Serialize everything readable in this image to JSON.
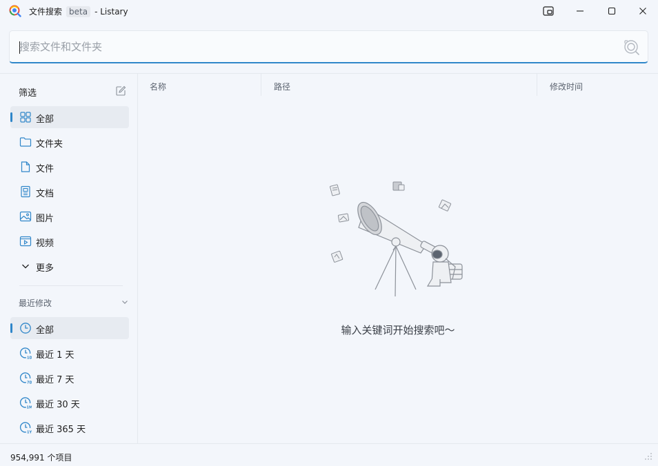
{
  "window": {
    "title": "文件搜索",
    "badge": "beta",
    "app_name": "- Listary"
  },
  "search": {
    "value": "",
    "placeholder": "搜索文件和文件夹"
  },
  "sidebar": {
    "filter_header": "筛选",
    "filters": [
      {
        "label": "全部",
        "icon": "grid-icon",
        "selected": true
      },
      {
        "label": "文件夹",
        "icon": "folder-icon",
        "selected": false
      },
      {
        "label": "文件",
        "icon": "file-icon",
        "selected": false
      },
      {
        "label": "文档",
        "icon": "document-icon",
        "selected": false
      },
      {
        "label": "图片",
        "icon": "image-icon",
        "selected": false
      },
      {
        "label": "视频",
        "icon": "video-icon",
        "selected": false
      },
      {
        "label": "更多",
        "icon": "chevron-down-icon",
        "selected": false
      }
    ],
    "recent_header": "最近修改",
    "recent": [
      {
        "label": "全部",
        "icon": "clock-icon",
        "selected": true
      },
      {
        "label": "最近 1 天",
        "icon": "clock-1d-icon",
        "selected": false
      },
      {
        "label": "最近 7 天",
        "icon": "clock-7d-icon",
        "selected": false
      },
      {
        "label": "最近 30 天",
        "icon": "clock-1m-icon",
        "selected": false
      },
      {
        "label": "最近 365 天",
        "icon": "clock-1y-icon",
        "selected": false
      }
    ]
  },
  "table": {
    "columns": [
      "名称",
      "路径",
      "修改时间"
    ]
  },
  "empty_state": {
    "message": "输入关键词开始搜索吧～",
    "illustration": "telescope-astronaut-illustration"
  },
  "status": {
    "count_text": "954,991 个项目"
  },
  "colors": {
    "accent": "#2f86c9",
    "background": "#f3f6fb"
  }
}
